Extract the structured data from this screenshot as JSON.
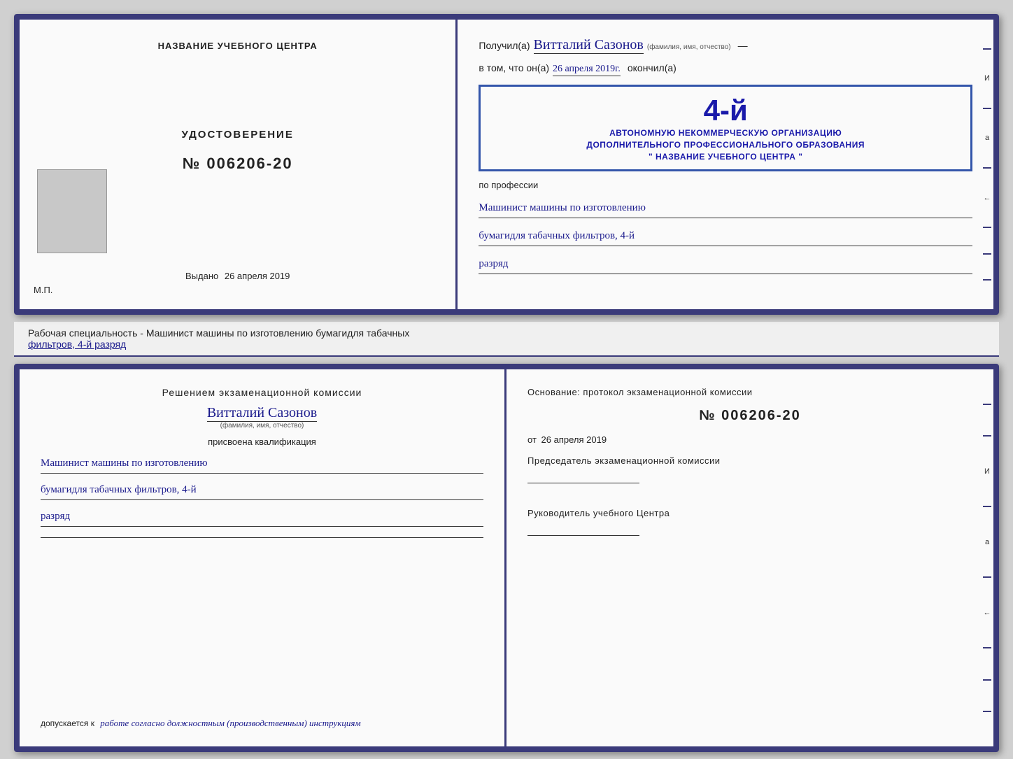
{
  "page": {
    "background_color": "#d0d0d0"
  },
  "top_diploma": {
    "left": {
      "center_title": "НАЗВАНИЕ УЧЕБНОГО ЦЕНТРА",
      "cert_label": "УДОСТОВЕРЕНИЕ",
      "cert_number": "№ 006206-20",
      "issued_label": "Выдано",
      "issued_date": "26 апреля 2019",
      "mp_label": "М.П."
    },
    "right": {
      "received_prefix": "Получил(а)",
      "recipient_name": "Витталий Сазонов",
      "recipient_hint": "(фамилия, имя, отчество)",
      "date_prefix": "в том, что он(а)",
      "date_value": "26 апреля 2019г.",
      "date_suffix": "окончил(а)",
      "stamp_number": "4-й",
      "stamp_line1": "АВТОНОМНУЮ НЕКОММЕРЧЕСКУЮ ОРГАНИЗАЦИЮ",
      "stamp_line2": "ДОПОЛНИТЕЛЬНОГО ПРОФЕССИОНАЛЬНОГО ОБРАЗОВАНИЯ",
      "stamp_line3": "\" НАЗВАНИЕ УЧЕБНОГО ЦЕНТРА \"",
      "profession_prefix": "по профессии",
      "profession_line1": "Машинист машины по изготовлению",
      "profession_line2": "бумагидля табачных фильтров, 4-й",
      "profession_line3": "разряд"
    },
    "side_chars": [
      "И",
      "а",
      "←"
    ]
  },
  "text_section": {
    "content": "Рабочая специальность - Машинист машины по изготовлению бумагидля табачных",
    "underlined": "фильтров, 4-й разряд"
  },
  "bottom_diploma": {
    "left": {
      "commission_title": "Решением  экзаменационной  комиссии",
      "person_name": "Витталий Сазонов",
      "person_hint": "(фамилия, имя, отчество)",
      "qualification_label": "присвоена квалификация",
      "qual_line1": "Машинист машины по изготовлению",
      "qual_line2": "бумагидля табачных фильтров, 4-й",
      "qual_line3": "разряд",
      "allowed_prefix": "допускается к",
      "allowed_text": "работе согласно должностным (производственным) инструкциям"
    },
    "right": {
      "basis_label": "Основание: протокол экзаменационной  комиссии",
      "protocol_number": "№  006206-20",
      "from_prefix": "от",
      "from_date": "26 апреля 2019",
      "chairman_label": "Председатель экзаменационной комиссии",
      "director_label": "Руководитель учебного Центра"
    },
    "side_chars": [
      "И",
      "а",
      "←"
    ]
  }
}
